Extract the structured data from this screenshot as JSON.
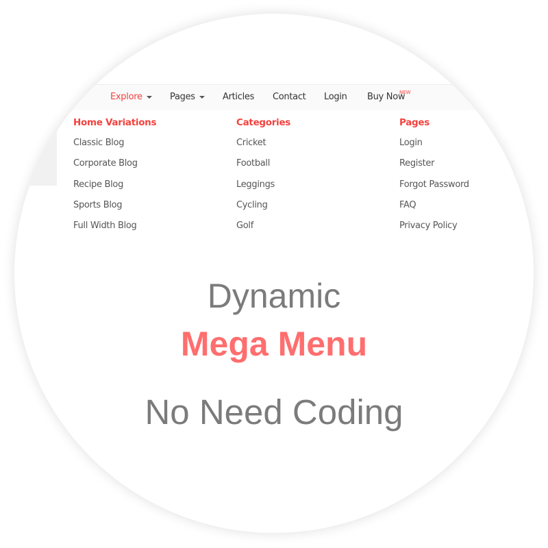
{
  "navbar": {
    "items": [
      {
        "label": "Explore",
        "has_dropdown": true,
        "active": true
      },
      {
        "label": "Pages",
        "has_dropdown": true
      },
      {
        "label": "Articles"
      },
      {
        "label": "Contact"
      },
      {
        "label": "Login"
      },
      {
        "label": "Buy Now",
        "badge": "NEW"
      }
    ]
  },
  "mega_menu": {
    "columns": [
      {
        "title": "Home Variations",
        "links": [
          "Classic Blog",
          "Corporate Blog",
          "Recipe Blog",
          "Sports Blog",
          "Full Width Blog"
        ]
      },
      {
        "title": "Categories",
        "links": [
          "Cricket",
          "Football",
          "Leggings",
          "Cycling",
          "Golf"
        ]
      },
      {
        "title": "Pages",
        "links": [
          "Login",
          "Register",
          "Forgot Password",
          "FAQ",
          "Privacy Policy"
        ]
      }
    ]
  },
  "hero": {
    "line1": "Dynamic",
    "line2": "Mega Menu",
    "line3": "No Need Coding"
  },
  "colors": {
    "accent": "#f2433f",
    "headline_accent": "#ff6e6e",
    "headline_gray": "#7b7b7b"
  }
}
